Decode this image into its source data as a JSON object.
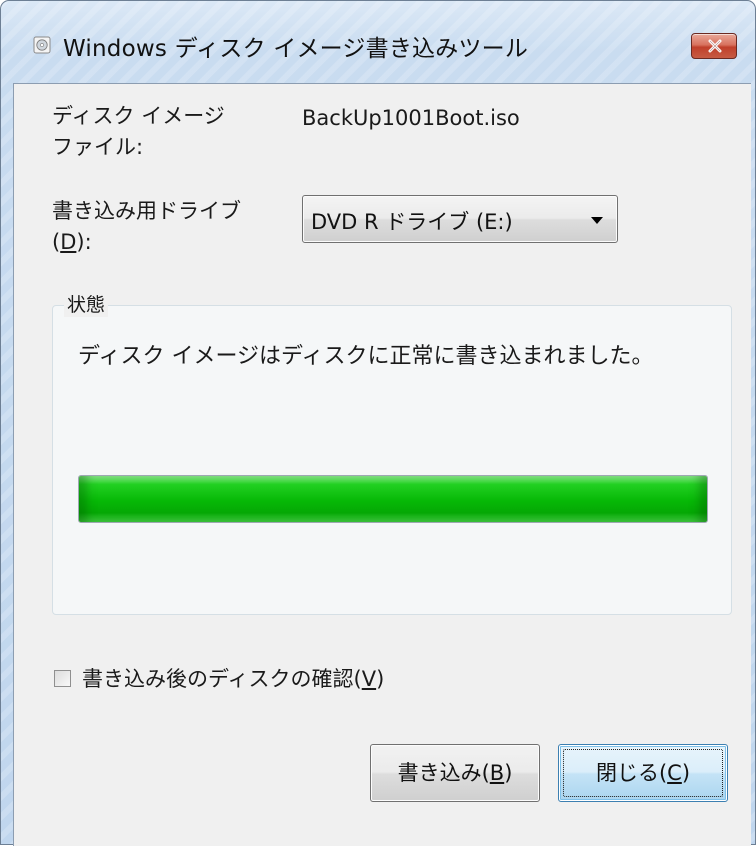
{
  "window": {
    "title": "Windows ディスク イメージ書き込みツール",
    "icon": "disc-burner-icon",
    "close_icon": "close-x-icon"
  },
  "form": {
    "image_file_label_line1": "ディスク イメージ",
    "image_file_label_line2": "ファイル:",
    "image_file_value": "BackUp1001Boot.iso",
    "drive_label_line1": "書き込み用ドライブ",
    "drive_label_prefix": "(",
    "drive_label_accel": "D",
    "drive_label_suffix": "):",
    "drive_selected": "DVD R ドライブ (E:)"
  },
  "status": {
    "group_title": "状態",
    "message": "ディスク イメージはディスクに正常に書き込まれました。",
    "progress_percent": 100,
    "progress_color": "#06b806"
  },
  "verify": {
    "label": "書き込み後のディスクの確認(",
    "accel": "V",
    "suffix": ")",
    "checked": false
  },
  "buttons": {
    "write_label": "書き込み(",
    "write_accel": "B",
    "write_suffix": ")",
    "close_label": "閉じる(",
    "close_accel": "C",
    "close_suffix": ")"
  }
}
